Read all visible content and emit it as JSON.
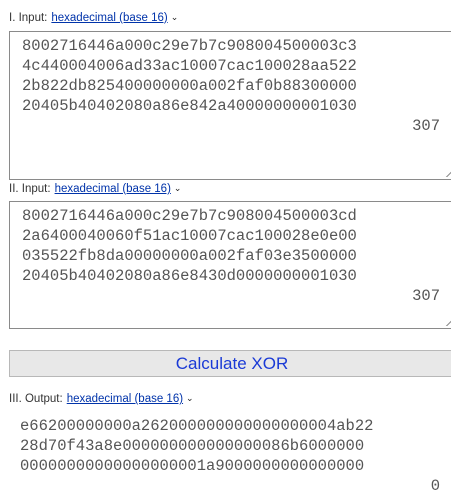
{
  "input1": {
    "label": "I. Input:",
    "format": "hexadecimal (base 16)",
    "lines": [
      "8002716446a000c29e7b7c908004500003c3",
      "4c440004006ad33ac10007cac100028aa522",
      "2b822db825400000000a002faf0b88300000",
      "20405b40402080a86e842a40000000001030",
      "307"
    ]
  },
  "input2": {
    "label": "II. Input:",
    "format": "hexadecimal (base 16)",
    "lines": [
      "8002716446a000c29e7b7c908004500003cd",
      "2a6400040060f51ac10007cac100028e0e00",
      "035522fb8da00000000a002faf03e3500000",
      "20405b40402080a86e8430d0000000001030",
      "307"
    ]
  },
  "calculate": {
    "label": "Calculate XOR"
  },
  "output": {
    "label": "III. Output:",
    "format": "hexadecimal (base 16)",
    "lines": [
      "e66200000000a262000000000000000004ab22",
      "28d70f43a8e000000000000000086b6000000",
      "00000000000000000001a9000000000000000",
      "0"
    ]
  },
  "icons": {
    "dropdown": "chevron-down-icon",
    "resize": "resize-grip-icon"
  },
  "colors": {
    "link": "#0033aa",
    "button_text": "#1a3ad6",
    "button_bg": "#e8e8e8",
    "text": "#555555"
  }
}
